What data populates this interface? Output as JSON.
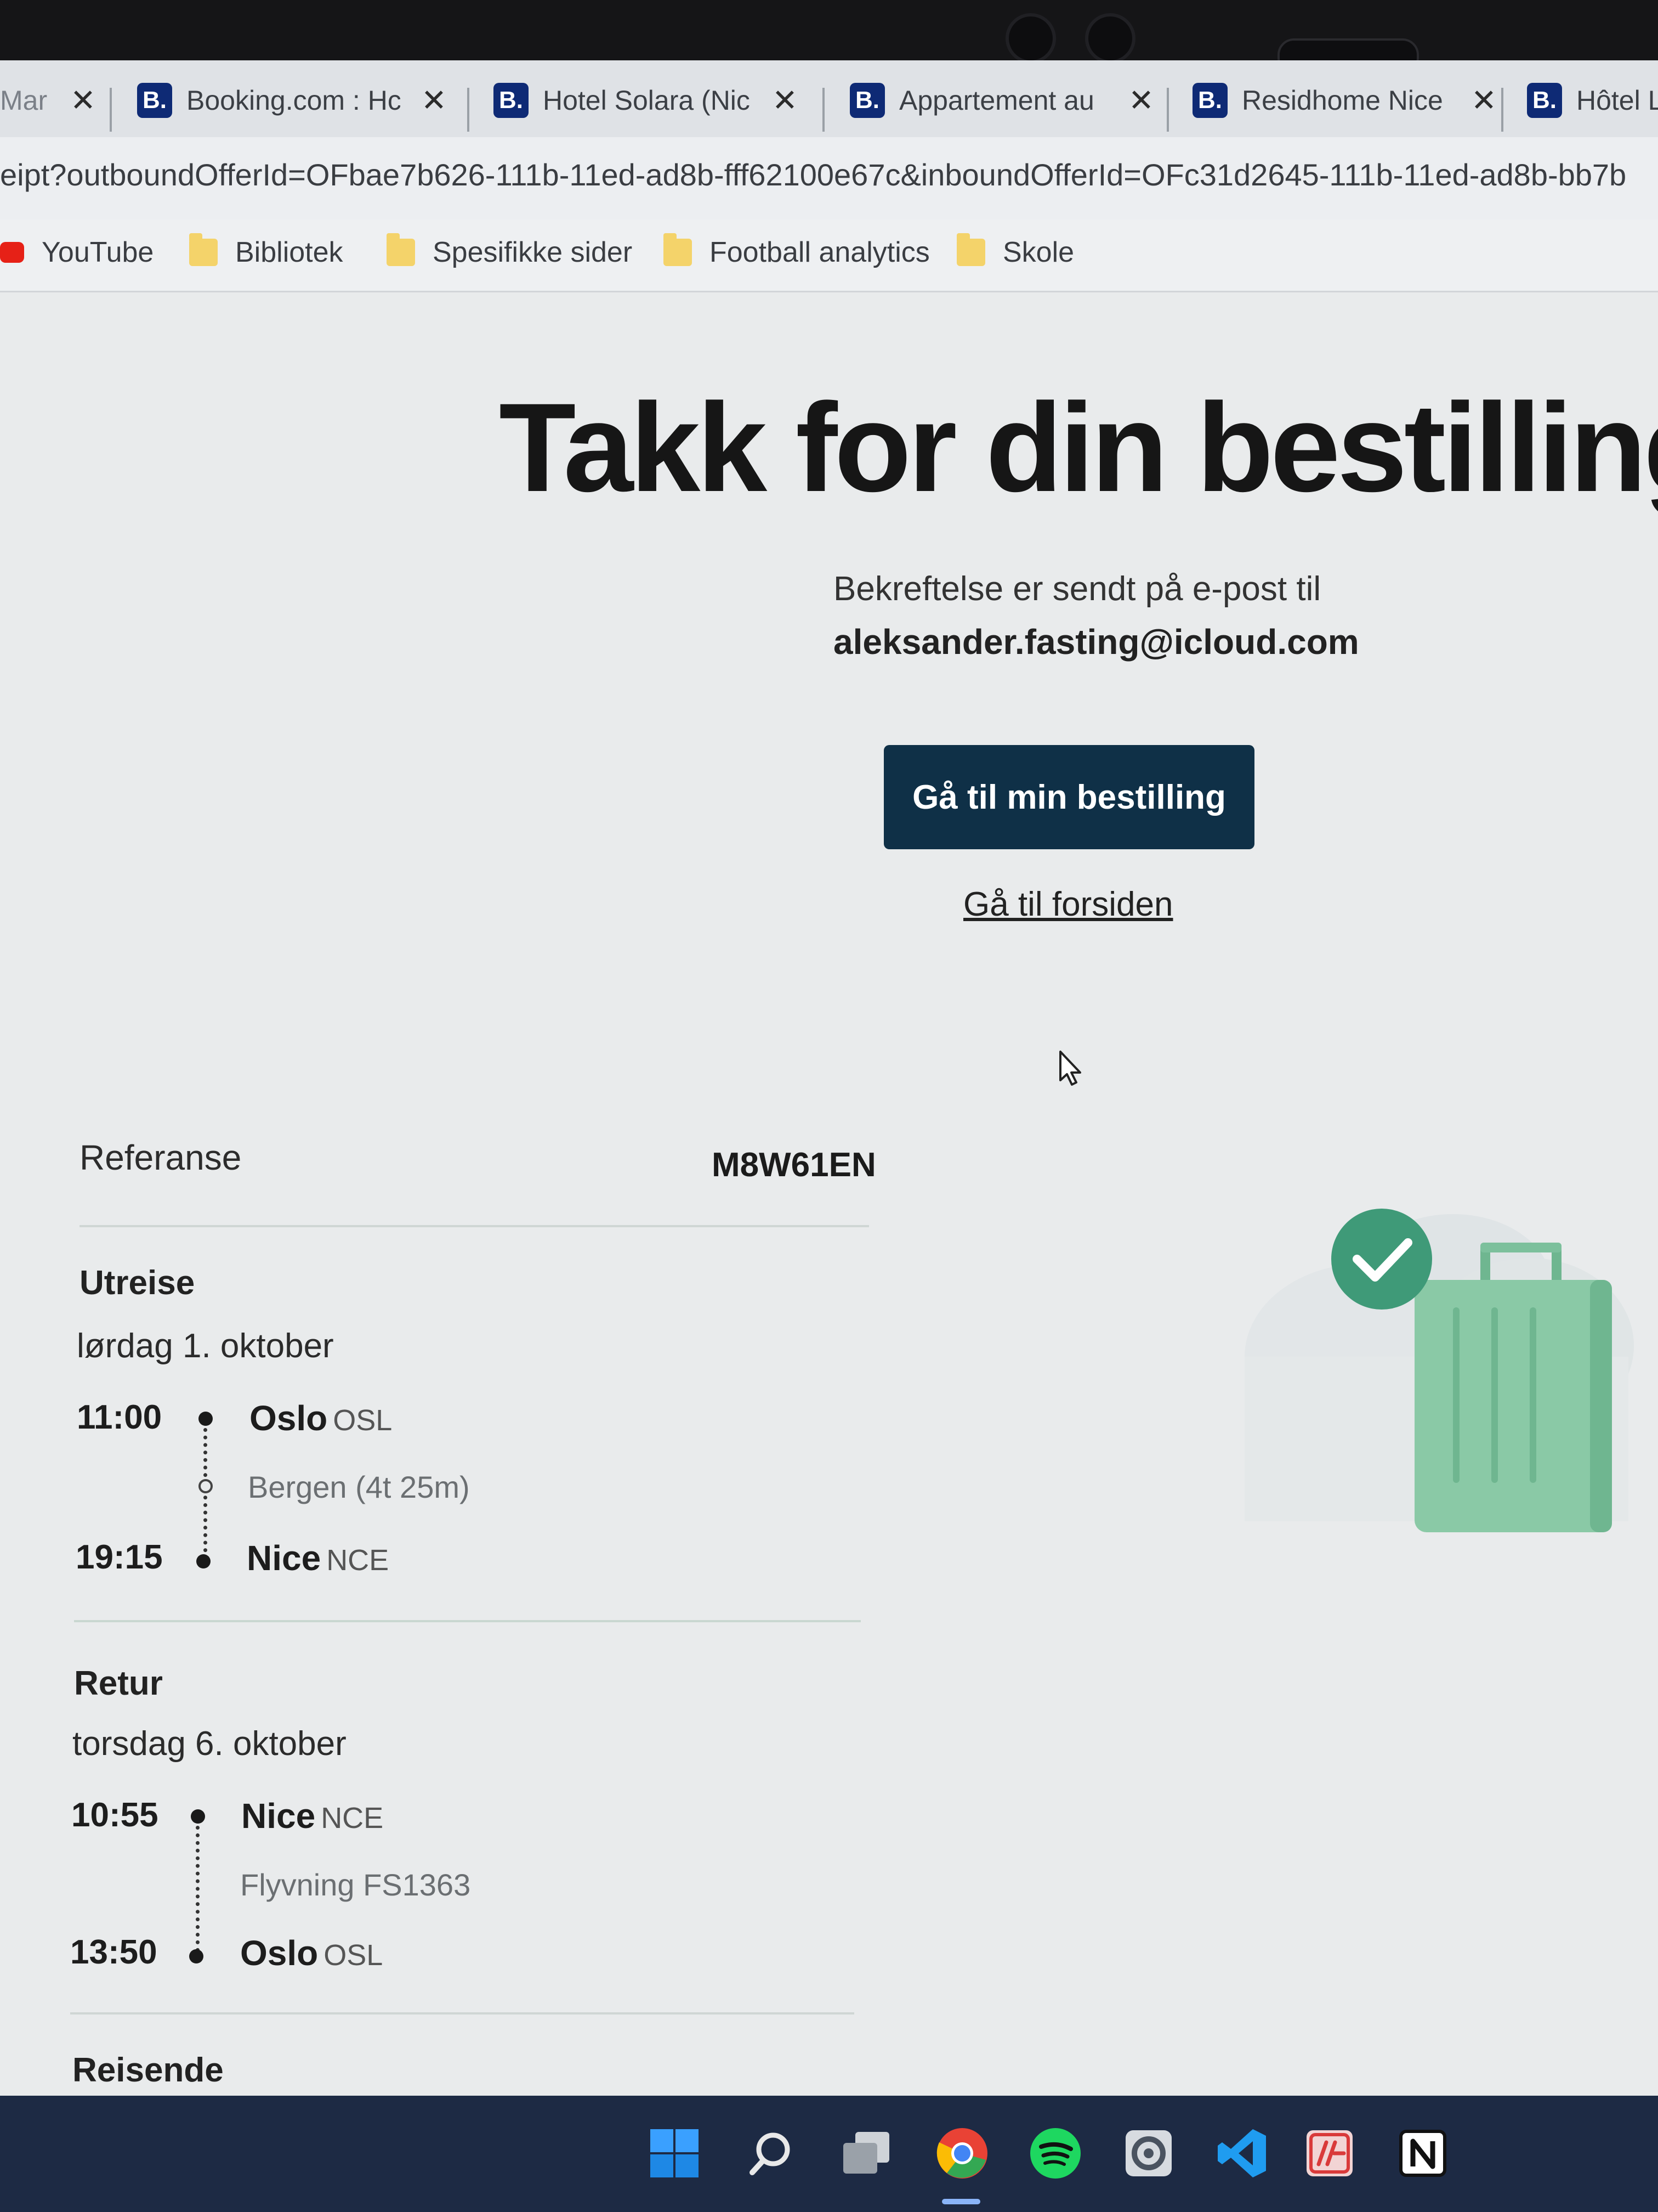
{
  "tabs": [
    {
      "favicon": "",
      "title": "Mar",
      "close": "✕"
    },
    {
      "favicon": "B.",
      "title": "Booking.com : Hc",
      "close": "✕"
    },
    {
      "favicon": "B.",
      "title": "Hotel Solara (Nic",
      "close": "✕"
    },
    {
      "favicon": "B.",
      "title": "Appartement au",
      "close": "✕"
    },
    {
      "favicon": "B.",
      "title": "Residhome Nice",
      "close": "✕"
    },
    {
      "favicon": "B.",
      "title": "Hôtel Le",
      "close": ""
    }
  ],
  "address": {
    "url": "eipt?outboundOfferId=OFbae7b626-111b-11ed-ad8b-fff62100e67c&inboundOfferId=OFc31d2645-111b-11ed-ad8b-bb7b"
  },
  "bookmarks": [
    {
      "label": "YouTube",
      "icon": "youtube-icon"
    },
    {
      "label": "Bibliotek",
      "icon": "folder-icon"
    },
    {
      "label": "Spesifikke sider",
      "icon": "folder-icon"
    },
    {
      "label": "Football analytics",
      "icon": "folder-icon"
    },
    {
      "label": "Skole",
      "icon": "folder-icon"
    }
  ],
  "main": {
    "headline": "Takk for din bestilling!",
    "confirmation_text": "Bekreftelse er sendt på e-post til",
    "email": "aleksander.fasting@icloud.com",
    "primary_button": "Gå til min bestilling",
    "home_link": "Gå til forsiden"
  },
  "booking": {
    "reference_label": "Referanse",
    "reference_value": "M8W61EN",
    "outbound": {
      "title": "Utreise",
      "date": "lørdag 1. oktober",
      "dep_time": "11:00",
      "dep_city": "Oslo",
      "dep_code": "OSL",
      "via": "Bergen (4t 25m)",
      "arr_time": "19:15",
      "arr_city": "Nice",
      "arr_code": "NCE"
    },
    "return": {
      "title": "Retur",
      "date": "torsdag 6. oktober",
      "dep_time": "10:55",
      "dep_city": "Nice",
      "dep_code": "NCE",
      "via": "Flyvning FS1363",
      "arr_time": "13:50",
      "arr_city": "Oslo",
      "arr_code": "OSL"
    },
    "travelers_title": "Reisende"
  },
  "colors": {
    "primary_button_bg": "#0f3047",
    "check_badge": "#3f9a78",
    "suitcase": "#8ac9a6",
    "taskbar": "#1d2a44"
  },
  "taskbar_icons": [
    "windows-start-icon",
    "search-icon",
    "task-view-icon",
    "chrome-icon",
    "spotify-icon",
    "settings-gear-icon",
    "vscode-icon",
    "adobe-app-icon",
    "notion-icon"
  ]
}
